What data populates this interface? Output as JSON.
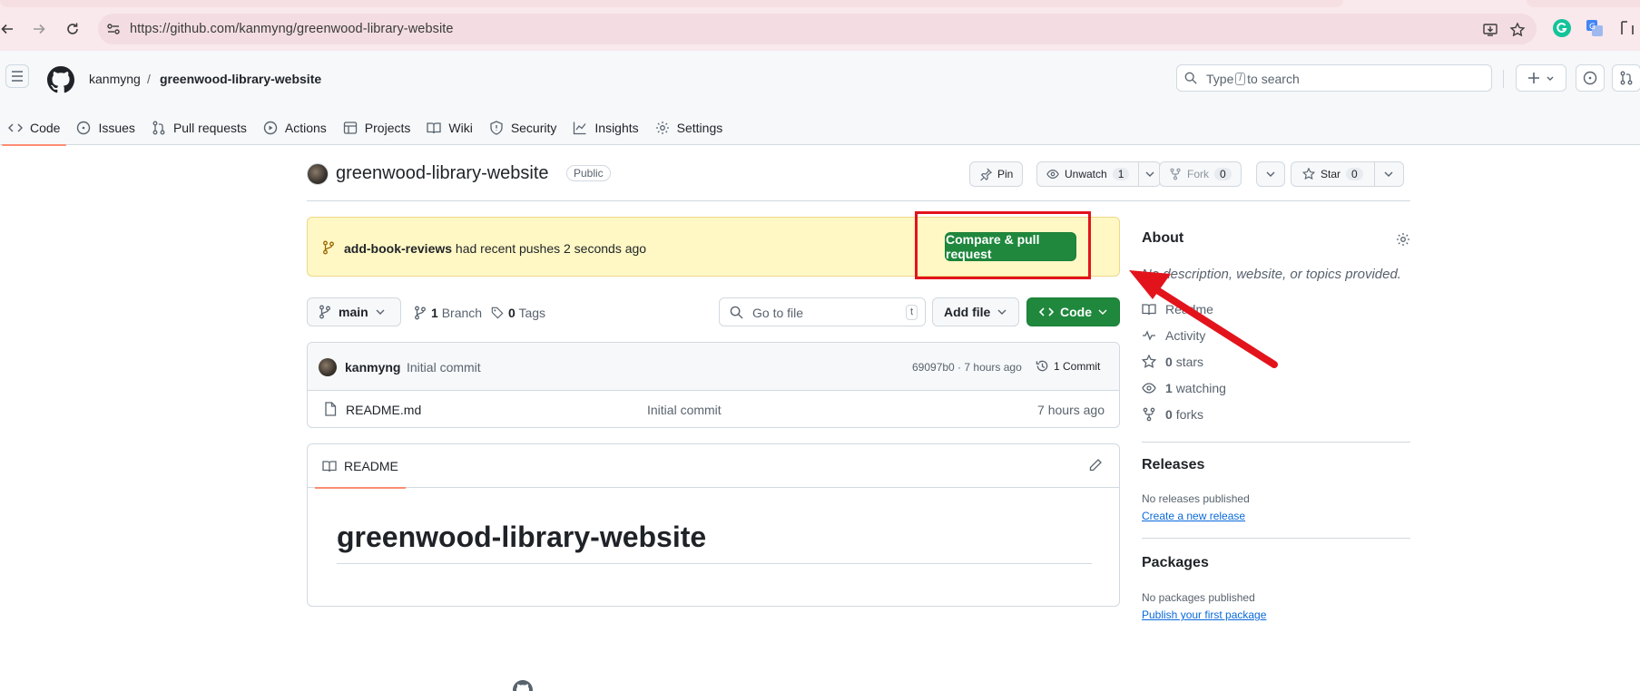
{
  "browser": {
    "url": "https://github.com/kanmyng/greenwood-library-website"
  },
  "header": {
    "owner": "kanmyng",
    "separator": "/",
    "repo": "greenwood-library-website",
    "search_prefix": "Type",
    "search_key": "/",
    "search_suffix": "to search"
  },
  "tabs": [
    {
      "label": "Code",
      "icon": "code-icon"
    },
    {
      "label": "Issues",
      "icon": "issue-icon"
    },
    {
      "label": "Pull requests",
      "icon": "pull-request-icon"
    },
    {
      "label": "Actions",
      "icon": "play-icon"
    },
    {
      "label": "Projects",
      "icon": "table-icon"
    },
    {
      "label": "Wiki",
      "icon": "book-icon"
    },
    {
      "label": "Security",
      "icon": "shield-icon"
    },
    {
      "label": "Insights",
      "icon": "graph-icon"
    },
    {
      "label": "Settings",
      "icon": "gear-icon"
    }
  ],
  "repo": {
    "name": "greenwood-library-website",
    "visibility": "Public",
    "pin_label": "Pin",
    "watch_label": "Unwatch",
    "watch_count": "1",
    "fork_label": "Fork",
    "fork_count": "0",
    "star_label": "Star",
    "star_count": "0"
  },
  "banner": {
    "branch": "add-book-reviews",
    "message": "had recent pushes 2 seconds ago",
    "button": "Compare & pull request"
  },
  "file_nav": {
    "branch": "main",
    "branch_count": "1",
    "branch_label": "Branch",
    "tag_count": "0",
    "tag_label": "Tags",
    "goto_placeholder": "Go to file",
    "goto_key": "t",
    "add_file": "Add file",
    "code": "Code"
  },
  "commit": {
    "author": "kanmyng",
    "message": "Initial commit",
    "hash_time": "69097b0 · 7 hours ago",
    "count": "1 Commit"
  },
  "files": [
    {
      "name": "README.md",
      "message": "Initial commit",
      "time": "7 hours ago"
    }
  ],
  "readme": {
    "tab": "README",
    "heading": "greenwood-library-website"
  },
  "about": {
    "title": "About",
    "description": "No description, website, or topics provided.",
    "readme": "Readme",
    "activity": "Activity",
    "stars_count": "0",
    "stars_label": "stars",
    "watching_count": "1",
    "watching_label": "watching",
    "forks_count": "0",
    "forks_label": "forks"
  },
  "releases": {
    "title": "Releases",
    "none": "No releases published",
    "link": "Create a new release"
  },
  "packages": {
    "title": "Packages",
    "none": "No packages published",
    "link": "Publish your first package"
  },
  "colors": {
    "primary_button": "#1f883d",
    "banner_bg": "#fff8c5",
    "annotation": "#e3131c",
    "tab_underline": "#fd8c73"
  }
}
